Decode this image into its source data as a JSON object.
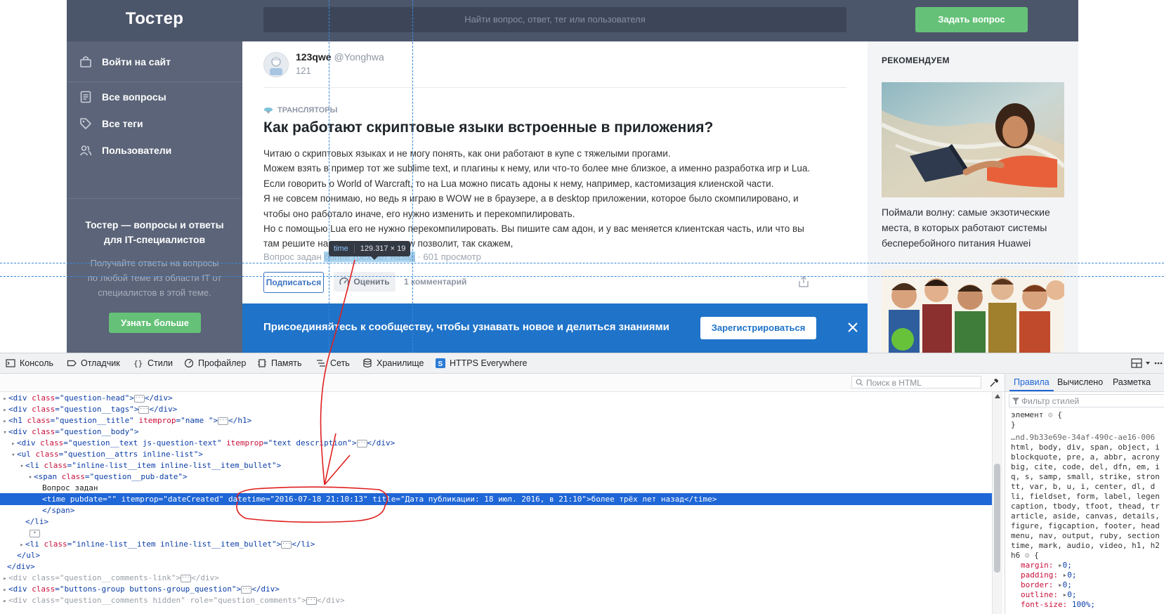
{
  "site": {
    "logo": "Тостер",
    "search_placeholder": "Найти вопрос, ответ, тег или пользователя",
    "ask_button": "Задать вопрос"
  },
  "sidebar": {
    "login": "Войти на сайт",
    "items": [
      {
        "label": "Все вопросы",
        "icon": "list-icon"
      },
      {
        "label": "Все теги",
        "icon": "tag-icon"
      },
      {
        "label": "Пользователи",
        "icon": "users-icon"
      }
    ],
    "promo_title": "Тостер — вопросы и ответы для IT-специалистов",
    "promo_text": "Получайте ответы на вопросы по любой теме из области IT от специалистов в этой теме.",
    "promo_button": "Узнать больше"
  },
  "question": {
    "author_name": "123qwe",
    "author_nick": "@Yonghwa",
    "author_score": "121",
    "tag": "ТРАНСЛЯТОРЫ",
    "title": "Как работают скриптовые языки встроенные в приложения?",
    "lines": [
      "Читаю о скриптовых языках и не могу понять, как они работают в купе с тяжелыми прогами.",
      "Можем взять в пример тот же sublime text, и плагины к нему, или что-то более мне близкое, а именно разработка игр и Lua.",
      "Если говорить о World of Warcraft, то на Lua можно писать адоны к нему, например, кастомизация клиенской части.",
      "Я не совсем понимаю, но ведь я играю в WOW не в браузере, а в desktop приложении, которое было скомпилировано, и",
      "чтобы оно работало иначе, его нужно изменить и перекомпилировать.",
      "Но с помощью Lua его не нужно перекомпилировать. Вы пишите сам адон, и у вас меняется клиентская часть, или что вы",
      "там решите написать, т.е сам wow позволит, так скажем,"
    ],
    "meta_prefix": "Вопрос задан ",
    "meta_time": "более трёх лет назад",
    "meta_suffix": " · 601 просмотр",
    "subscribe": "Подписаться",
    "rate": "Оценить",
    "comments": "1 комментарий"
  },
  "join_banner": {
    "text": "Присоединяйтесь к сообществу, чтобы узнавать новое и делиться знаниями",
    "button": "Зарегистрироваться"
  },
  "recommend": {
    "title": "РЕКОМЕНДУЕМ",
    "caption": "Поймали волну: самые экзотические места, в которых работают системы бесперебойного питания Huawei"
  },
  "tooltip": {
    "tag": "time",
    "dims": "129.317 × 19"
  },
  "devtools": {
    "tabs": [
      "Консоль",
      "Отладчик",
      "Стили",
      "Профайлер",
      "Память",
      "Сеть",
      "Хранилище",
      "HTTPS Everywhere"
    ],
    "html_search": "Поиск в HTML",
    "rules_tabs": [
      "Правила",
      "Вычислено",
      "Разметка"
    ],
    "rules_filter": "Фильтр стилей",
    "markup_text_node": "Вопрос задан",
    "rules_lines": {
      "element": "элемент",
      "open": "{",
      "close": "}",
      "source": "…nd.9b33e69e-34af-490c-ae16-006",
      "sel1": "html, body, div, span, object, i",
      "sel2": "blockquote, pre, a, abbr, acrony",
      "sel3": "big, cite, code, del, dfn, em, i",
      "sel4": "q, s, samp, small, strike, stron",
      "sel5": "tt, var, b, u, i, center, dl, d",
      "sel6": "li, fieldset, form, label, legen",
      "sel7": "caption, tbody, tfoot, thead, tr",
      "sel8": "article, aside, canvas, details,",
      "sel9": "figure, figcaption, footer, head",
      "sel10": "menu, nav, output, ruby, section",
      "sel11": "time, mark, audio, video, h1, h2",
      "sel12": "h6",
      "p_margin": "margin:",
      "p_padding": "padding:",
      "p_border": "border:",
      "p_outline": "outline:",
      "p_fontsize": "font-size:",
      "v_zero": "0;",
      "v_100": "100%;"
    }
  },
  "markup": {
    "qhead": "question-head",
    "qtags": "question__tags",
    "qtitle": "question__title",
    "itemprop_name": "name ",
    "qbody": "question__body",
    "qtext": "question__text js-question-text",
    "itemprop_textdesc": "text description",
    "qattrs": "question__attrs inline-list",
    "li_cls": "inline-list__item inline-list__item_bullet",
    "pubdate_cls": "question__pub-date",
    "itemprop_date": "dateCreated",
    "datetime": "2016-07-18 21:10:13",
    "title_attr": "Дата публикации: 18 июл. 2016, в 21:10",
    "time_text": "более трёх лет назад",
    "comments_link_cls": "question__comments-link",
    "buttons_cls": "buttons-group buttons-group_question",
    "hidden_cls": "question__comments hidden",
    "role_val": "question_comments",
    "empty": ""
  },
  "colors": {
    "sidebar": "#5b6478",
    "header": "#4c566b",
    "accent_green": "#65c178",
    "banner_blue": "#1f73c9",
    "selection_blue": "#1f66d6",
    "annotation_red": "#e02020"
  }
}
